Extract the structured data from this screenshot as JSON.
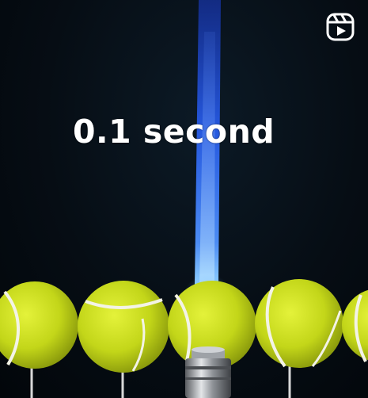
{
  "video": {
    "caption": "0.1 second",
    "reel_icon": "reels-icon",
    "scene": {
      "background_color": "#060d14",
      "flame_color": "#2f6bff",
      "ball_color": "#c8dc1e",
      "ball_count_visible": 5,
      "torch_color": "#b9bcc0"
    }
  }
}
